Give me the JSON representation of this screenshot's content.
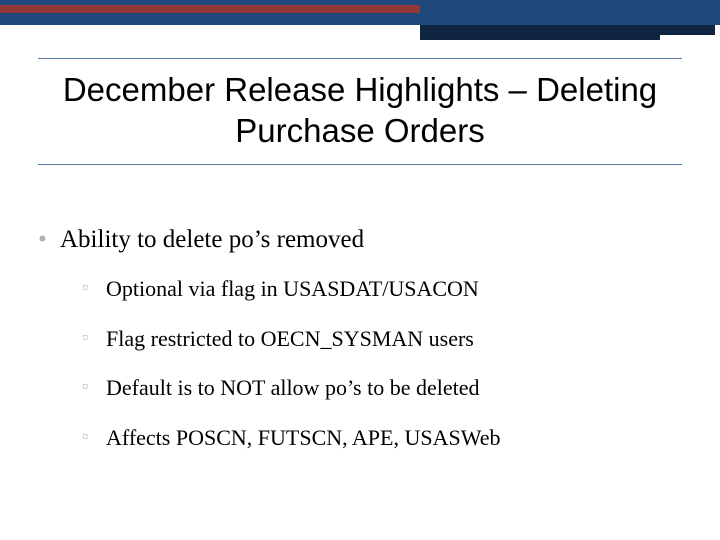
{
  "title": "December Release Highlights – Deleting Purchase Orders",
  "bullets": {
    "l1": "Ability to delete po’s removed",
    "l2": [
      "Optional via flag in USASDAT/USACON",
      "Flag restricted to OECN_SYSMAN users",
      "Default is to NOT allow po’s to be deleted",
      "Affects POSCN, FUTSCN, APE, USASWeb"
    ]
  },
  "colors": {
    "band": "#1f497d",
    "bandDark": "#0f243e",
    "accent": "#953734",
    "rule": "#5a7ca8"
  }
}
